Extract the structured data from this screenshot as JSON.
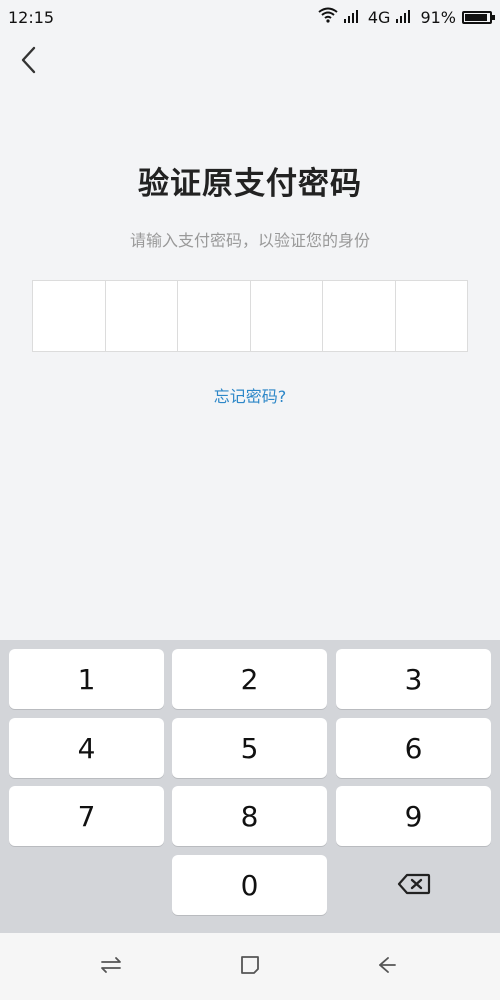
{
  "status_bar": {
    "time": "12:15",
    "network": "4G",
    "battery_percent": "91%",
    "battery_level": 0.91
  },
  "header": {
    "back_icon": "chevron-left-icon",
    "title": "验证原支付密码",
    "subtitle": "请输入支付密码，以验证您的身份"
  },
  "pin": {
    "length": 6
  },
  "forgot_password": "忘记密码?",
  "keypad": {
    "keys": [
      "1",
      "2",
      "3",
      "4",
      "5",
      "6",
      "7",
      "8",
      "9",
      "0"
    ],
    "delete_icon": "backspace-icon"
  },
  "nav_bar": {
    "icons": [
      "menu-switch-icon",
      "home-square-icon",
      "back-arrow-icon"
    ]
  },
  "colors": {
    "background": "#f3f4f6",
    "link": "#2d87c8",
    "keypad_bg": "#d3d5d9"
  }
}
